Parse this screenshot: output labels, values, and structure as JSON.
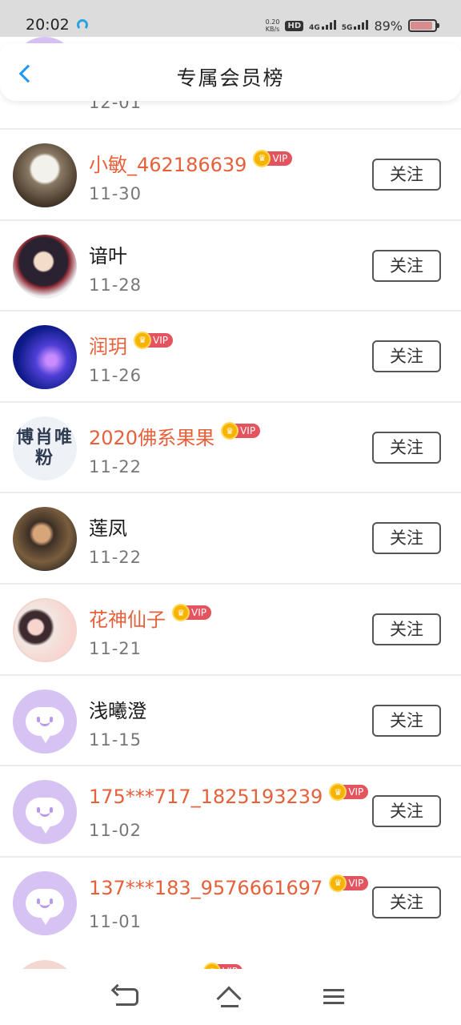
{
  "status_bar": {
    "time": "20:02",
    "net_speed_value": "0.20",
    "net_speed_unit": "KB/s",
    "hd_label": "HD",
    "net_4g": "4G",
    "net_5g": "5G",
    "battery": "89%",
    "battery_level": 0.89
  },
  "header": {
    "title": "专属会员榜",
    "back_icon": "chevron-left-icon"
  },
  "vip_tag": "VIP",
  "follow_label": "关注",
  "partial_top_date": "12-01",
  "members": [
    {
      "name": "小敏_462186639",
      "date": "11-30",
      "vip": true,
      "avatar": "cat-photo"
    },
    {
      "name": "谙叶",
      "date": "11-28",
      "vip": false,
      "avatar": "anime-character"
    },
    {
      "name": "润玥",
      "date": "11-26",
      "vip": true,
      "avatar": "sparkle-image"
    },
    {
      "name": "2020佛系果果",
      "date": "11-22",
      "vip": true,
      "avatar": "text-image",
      "avatar_text": "博肖唯粉"
    },
    {
      "name": "莲凤",
      "date": "11-22",
      "vip": false,
      "avatar": "person-photo"
    },
    {
      "name": "花神仙子",
      "date": "11-21",
      "vip": true,
      "avatar": "anime-duo"
    },
    {
      "name": "浅曦澄",
      "date": "11-15",
      "vip": false,
      "avatar": "default-chat-avatar"
    },
    {
      "name": "175***717_1825193239",
      "date": "11-02",
      "vip": true,
      "avatar": "default-chat-avatar"
    },
    {
      "name": "137***183_9576661697",
      "date": "11-01",
      "vip": true,
      "avatar": "default-chat-avatar"
    }
  ],
  "colors": {
    "vip_name": "#e5603b",
    "vip_tag_bg": "#e3545f",
    "crown": "#f6b400",
    "back_arrow": "#2196f3",
    "default_avatar_bg": "#d7c3f3"
  },
  "nav_bar": {
    "back_icon": "back-arrow-icon",
    "home_icon": "home-icon",
    "menu_icon": "menu-icon"
  }
}
